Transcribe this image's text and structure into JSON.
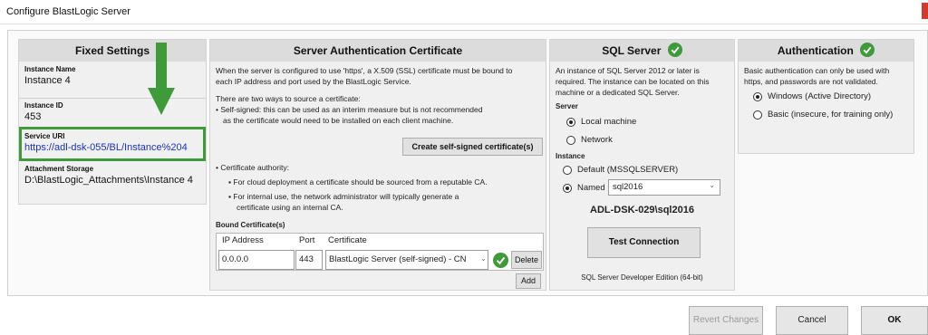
{
  "window": {
    "title": "Configure BlastLogic Server"
  },
  "fixed_settings": {
    "heading": "Fixed Settings",
    "instance_name_label": "Instance Name",
    "instance_name": "Instance 4",
    "instance_id_label": "Instance ID",
    "instance_id": "453",
    "service_uri_label": "Service URI",
    "service_uri": "https://adl-dsk-055/BL/Instance%204",
    "attachment_storage_label": "Attachment Storage",
    "attachment_storage": "D:\\BlastLogic_Attachments\\Instance 4"
  },
  "certificate": {
    "heading": "Server Authentication Certificate",
    "intro_line1": "When the server is configured to use 'https', a X.509 (SSL) certificate must be bound to",
    "intro_line2": "each IP address and port used by the BlastLogic Service.",
    "ways": "There are two ways to source a certificate:",
    "selfsigned_line1": "• Self-signed: this can be used as an interim measure but is not recommended",
    "selfsigned_line2": "as the certificate would need to be installed on each client machine.",
    "create_button": "Create self-signed certificate(s)",
    "authority": "• Certificate authority:",
    "cloud": "▪  For cloud deployment a certificate should be sourced from a reputable CA.",
    "internal_line1": "▪  For internal use, the network administrator will typically generate a",
    "internal_line2": "certificate using an internal CA.",
    "bound_label": "Bound Certificate(s)",
    "columns": [
      "IP Address",
      "Port",
      "Certificate"
    ],
    "row": {
      "ip": "0.0.0.0",
      "port": "443",
      "cert": "BlastLogic Server (self-signed) - CN"
    },
    "delete_button": "Delete",
    "add_button": "Add"
  },
  "sql": {
    "heading": "SQL Server",
    "desc_line1": "An instance of SQL Server 2012 or later is",
    "desc_line2": "required. The instance can be located on this",
    "desc_line3": "machine or a dedicated SQL Server.",
    "server_label": "Server",
    "local_machine": "Local machine",
    "network": "Network",
    "instance_label": "Instance",
    "default_instance": "Default (MSSQLSERVER)",
    "named": "Named",
    "named_value": "sql2016",
    "server_name": "ADL-DSK-029\\sql2016",
    "test_button": "Test Connection",
    "edition": "SQL Server Developer Edition (64-bit)"
  },
  "auth": {
    "heading": "Authentication",
    "desc_line1": "Basic authentication can only be used with",
    "desc_line2": "https, and passwords are not validated.",
    "windows": "Windows (Active Directory)",
    "basic": "Basic (insecure, for training only)"
  },
  "footer": {
    "revert": "Revert Changes",
    "cancel": "Cancel",
    "ok": "OK"
  },
  "colors": {
    "accent_green": "#3f9a3a",
    "link_blue": "#1a33b8",
    "close_red": "#d23a2f"
  }
}
